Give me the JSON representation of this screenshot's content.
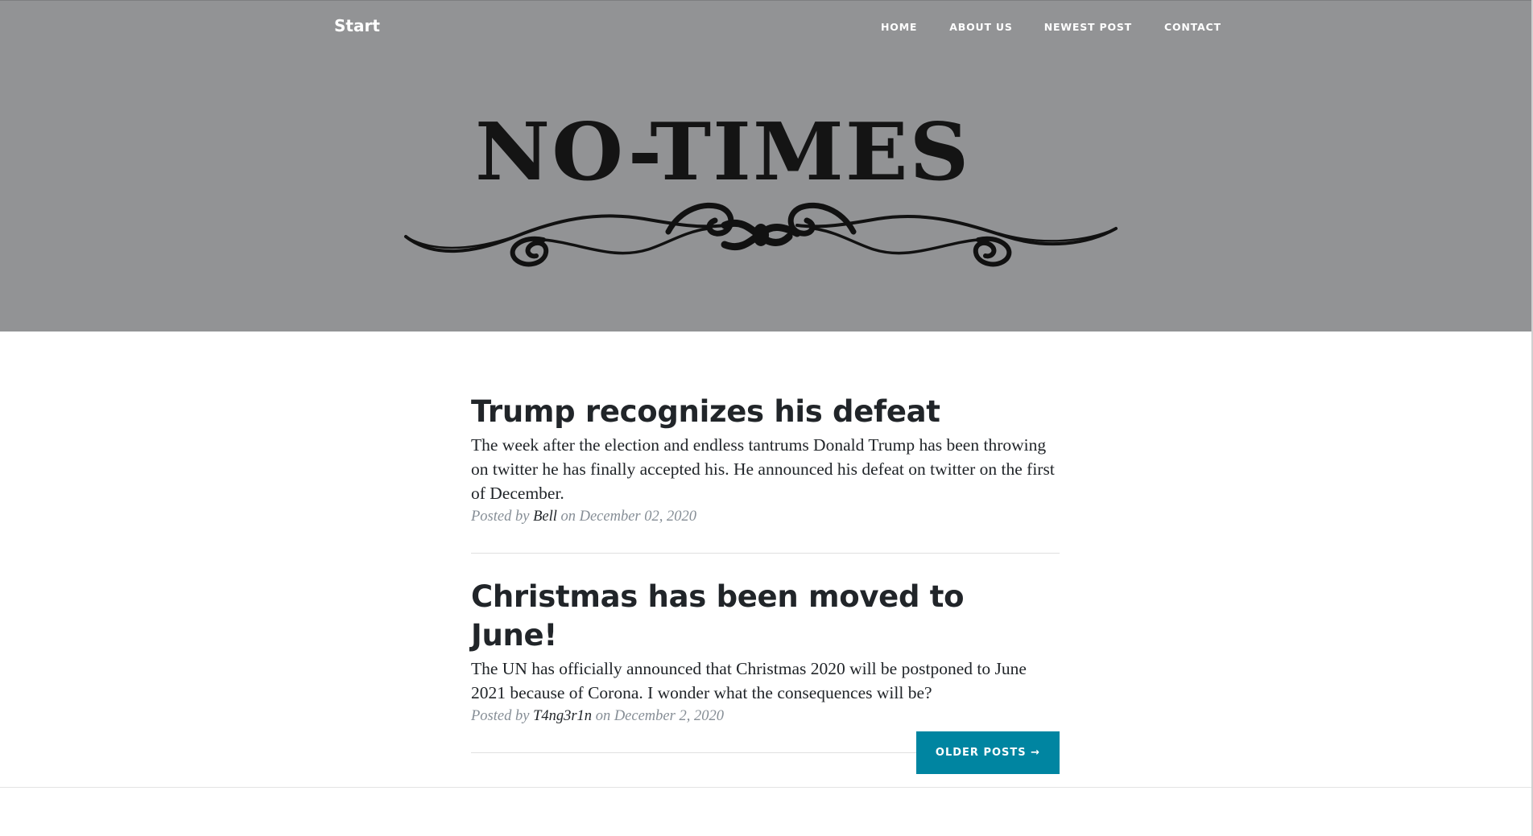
{
  "nav": {
    "brand": "Start",
    "items": [
      {
        "label": "Home"
      },
      {
        "label": "About Us"
      },
      {
        "label": "Newest Post"
      },
      {
        "label": "Contact"
      }
    ]
  },
  "header": {
    "logo_text": "NO-TIMES"
  },
  "posts": [
    {
      "title": "Trump recognizes his defeat",
      "excerpt": "The week after the election and endless tantrums Donald Trump has been throwing on twitter he has finally accepted his. He announced his defeat on twitter on the first of December.",
      "meta_prefix": "Posted by",
      "author": "Bell",
      "meta_on": "on",
      "date": "December 02, 2020"
    },
    {
      "title": "Christmas has been moved to June!",
      "excerpt": "The UN has officially announced that Christmas 2020 will be postponed to June 2021 because of Corona. I wonder what the consequences will be?",
      "meta_prefix": "Posted by",
      "author": "T4ng3r1n",
      "meta_on": "on",
      "date": "December 2, 2020"
    }
  ],
  "pager": {
    "older_label": "Older Posts →"
  },
  "colors": {
    "masthead_bg": "#929395",
    "button_bg": "#0085a1",
    "text": "#212529",
    "muted": "#868e96"
  }
}
